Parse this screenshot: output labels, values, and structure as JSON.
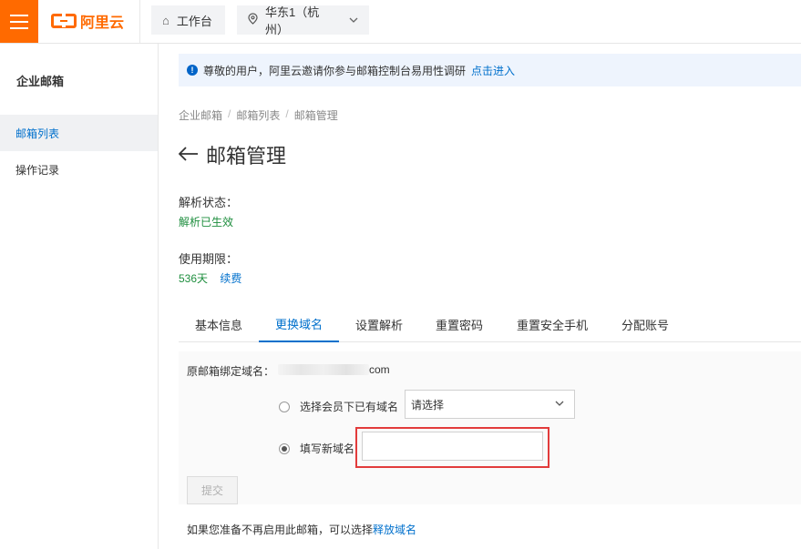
{
  "header": {
    "logo_text": "阿里云",
    "workbench_label": "工作台",
    "region_label": "华东1（杭州）",
    "icons": {
      "menu": "hamburger-menu-icon",
      "workbench": "home-icon",
      "region": "location-pin-icon"
    },
    "brand_color": "#ff6a00"
  },
  "sidebar": {
    "title": "企业邮箱",
    "items": [
      {
        "label": "邮箱列表",
        "active": true
      },
      {
        "label": "操作记录",
        "active": false
      }
    ]
  },
  "notice": {
    "text": "尊敬的用户，阿里云邀请你参与邮箱控制台易用性调研",
    "link": "点击进入"
  },
  "breadcrumb": [
    "企业邮箱",
    "邮箱列表",
    "邮箱管理"
  ],
  "page": {
    "title": "邮箱管理",
    "resolve_status_label": "解析状态：",
    "resolve_status_value": "解析已生效",
    "period_label": "使用期限：",
    "period_value": "536天",
    "renew_link": "续费"
  },
  "tabs": [
    {
      "label": "基本信息",
      "active": false
    },
    {
      "label": "更换域名",
      "active": true
    },
    {
      "label": "设置解析",
      "active": false
    },
    {
      "label": "重置密码",
      "active": false
    },
    {
      "label": "重置安全手机",
      "active": false
    },
    {
      "label": "分配账号",
      "active": false
    }
  ],
  "form": {
    "original_domain_label": "原邮箱绑定域名：",
    "original_domain_suffix": "com",
    "option_existing_label": "选择会员下已有域名",
    "option_existing_checked": false,
    "select_placeholder": "请选择",
    "option_new_label": "填写新域名",
    "option_new_checked": true,
    "new_domain_value": "",
    "submit_label": "提交"
  },
  "footer_note": {
    "text": "如果您准备不再启用此邮箱，可以选择",
    "link": "释放域名"
  },
  "colors": {
    "accent": "#0070cc",
    "success": "#1e8e3e",
    "highlight": "#e23b3b"
  }
}
